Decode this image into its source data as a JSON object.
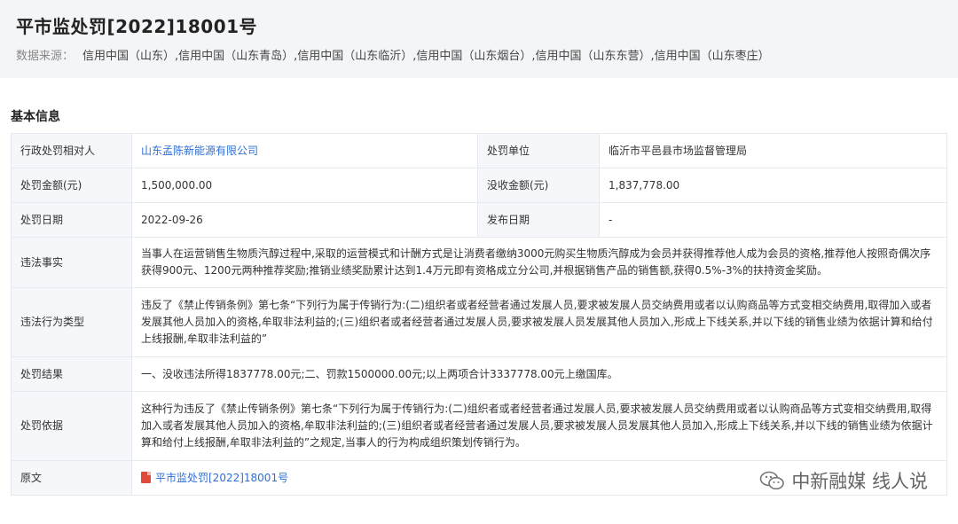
{
  "header": {
    "title": "平市监处罚[2022]18001号",
    "source_label": "数据来源：",
    "source_value": "信用中国（山东）,信用中国（山东青岛）,信用中国（山东临沂）,信用中国（山东烟台）,信用中国（山东东营）,信用中国（山东枣庄）"
  },
  "section": {
    "title": "基本信息"
  },
  "rows": {
    "party_label": "行政处罚相对人",
    "party_value": "山东孟陈新能源有限公司",
    "unit_label": "处罚单位",
    "unit_value": "临沂市平邑县市场监督管理局",
    "amount_label": "处罚金额(元)",
    "amount_value": "1,500,000.00",
    "confiscate_label": "没收金额(元)",
    "confiscate_value": "1,837,778.00",
    "date_label": "处罚日期",
    "date_value": "2022-09-26",
    "publish_label": "发布日期",
    "publish_value": "-",
    "facts_label": "违法事实",
    "facts_value": "当事人在运营销售生物质汽醇过程中,采取的运营模式和计酬方式是让消费者缴纳3000元购买生物质汽醇成为会员并获得推荐他人成为会员的资格,推荐他人按照奇偶次序获得900元、1200元两种推荐奖励;推销业绩奖励累计达到1.4万元即有资格成立分公司,并根据销售产品的销售额,获得0.5%-3%的扶持资金奖励。",
    "type_label": "违法行为类型",
    "type_value": "违反了《禁止传销条例》第七条“下列行为属于传销行为:(二)组织者或者经营者通过发展人员,要求被发展人员交纳费用或者以认购商品等方式变相交纳费用,取得加入或者发展其他人员加入的资格,牟取非法利益的;(三)组织者或者经营者通过发展人员,要求被发展人员发展其他人员加入,形成上下线关系,并以下线的销售业绩为依据计算和给付上线报酬,牟取非法利益的”",
    "result_label": "处罚结果",
    "result_value": "一、没收违法所得1837778.00元;二、罚款1500000.00元;以上两项合计3337778.00元上缴国库。",
    "basis_label": "处罚依据",
    "basis_value": "这种行为违反了《禁止传销条例》第七条“下列行为属于传销行为:(二)组织者或者经营者通过发展人员,要求被发展人员交纳费用或者以认购商品等方式变相交纳费用,取得加入或者发展其他人员加入的资格,牟取非法利益的;(三)组织者或者经营者通过发展人员,要求被发展人员发展其他人员加入,形成上下线关系,并以下线的销售业绩为依据计算和给付上线报酬,牟取非法利益的”之规定,当事人的行为构成组织策划传销行为。",
    "original_label": "原文",
    "original_value": "平市监处罚[2022]18001号",
    "original_icon": "pdf-icon"
  },
  "watermark": {
    "text": "中新融媒 线人说",
    "icon": "wechat-icon"
  }
}
